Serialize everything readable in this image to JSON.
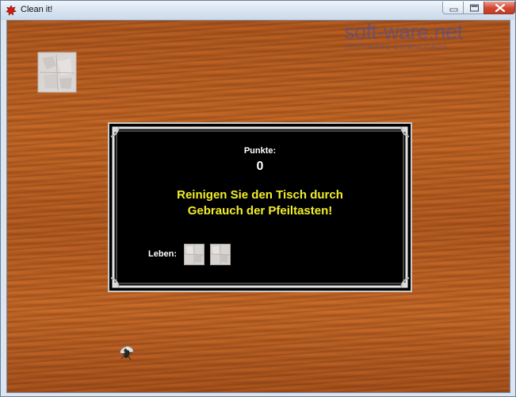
{
  "window": {
    "title": "Clean it!"
  },
  "watermark": {
    "main": "soft-ware.net",
    "sub": "SOFTWARE DOWNLOADS"
  },
  "game": {
    "points_label": "Punkte:",
    "score": "0",
    "message_line1": "Reinigen Sie den Tisch durch",
    "message_line2": "Gebrauch der Pfeiltasten!",
    "lives_label": "Leben:",
    "lives_remaining": 2
  },
  "colors": {
    "message": "#f2ee2a",
    "panel_background": "#000000",
    "table_wood": "#c0652a",
    "close_button": "#d2462f"
  },
  "icons": [
    "app-stain-icon",
    "minimize-icon",
    "maximize-icon",
    "close-icon",
    "napkin-sprite",
    "fly-sprite",
    "life-napkin-icon"
  ]
}
